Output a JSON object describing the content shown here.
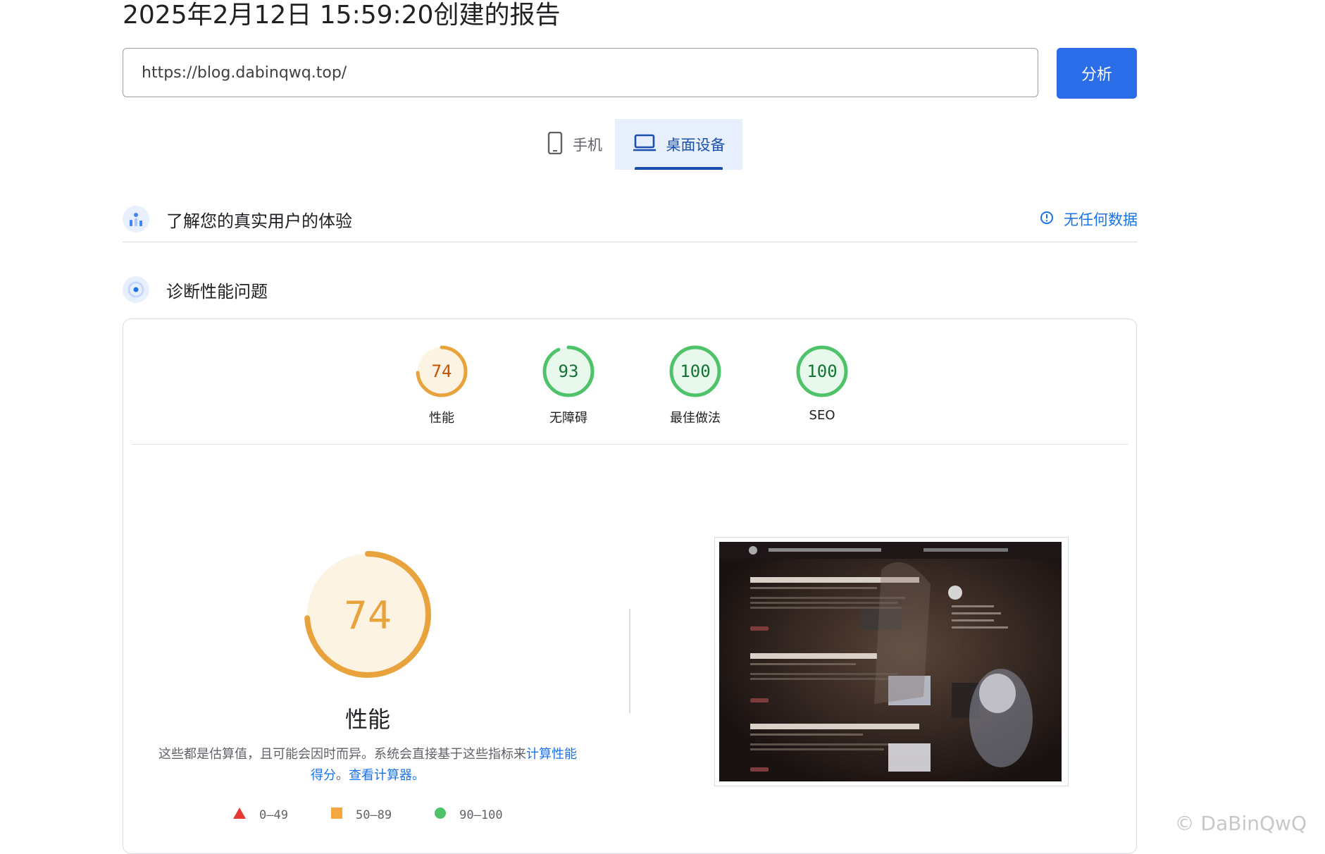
{
  "report": {
    "title": "2025年2月12日 15:59:20创建的报告",
    "url_value": "https://blog.dabinqwq.top/",
    "analyze_label": "分析"
  },
  "device_tabs": [
    {
      "label": "手机",
      "icon": "smartphone-icon",
      "selected": false
    },
    {
      "label": "桌面设备",
      "icon": "laptop-icon",
      "selected": true
    }
  ],
  "crux_section": {
    "label": "了解您的真实用户的体验",
    "status": "无任何数据",
    "status_icon": "info-icon"
  },
  "diagnose_section": {
    "label": "诊断性能问题"
  },
  "scores": [
    {
      "value": "74",
      "label": "性能",
      "color": "#e8a33d",
      "fraction": 0.74
    },
    {
      "value": "93",
      "label": "无障碍",
      "color": "#4fc36a",
      "fraction": 0.93
    },
    {
      "value": "100",
      "label": "最佳做法",
      "color": "#4fc36a",
      "fraction": 1.0
    },
    {
      "value": "100",
      "label": "SEO",
      "color": "#4fc36a",
      "fraction": 1.0
    }
  ],
  "performance": {
    "score": "74",
    "label": "性能",
    "desc_prefix": "这些都是估算值，且可能会因时而异。系统会直接基于这些指标来",
    "desc_link1": "计算性能得分",
    "desc_mid": "。",
    "desc_link2": "查看计算器。",
    "color_average": "#e8a33d",
    "color_fail": "#e53935",
    "color_pass": "#4fc36a"
  },
  "legend": [
    {
      "range": "0–49",
      "shape": "triangle"
    },
    {
      "range": "50–89",
      "shape": "square"
    },
    {
      "range": "90–100",
      "shape": "circle"
    }
  ],
  "watermark": "© DaBinQwQ"
}
